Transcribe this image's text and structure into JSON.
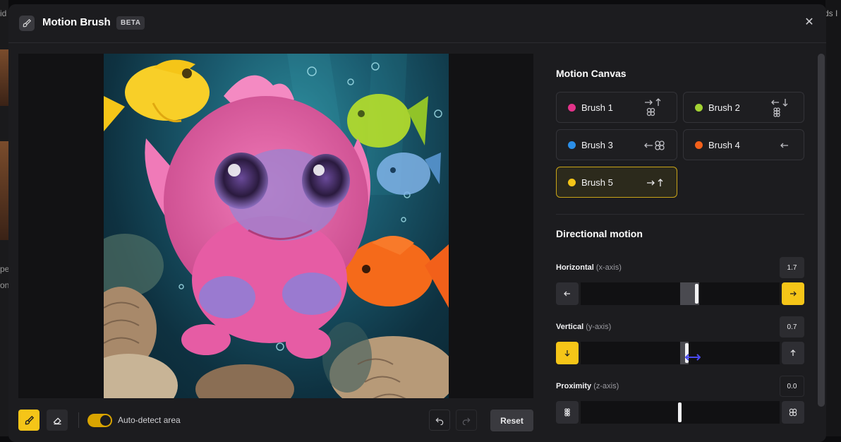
{
  "background": {
    "left_text": [
      "id",
      "pe",
      "on"
    ],
    "right_text": "ds I"
  },
  "header": {
    "title": "Motion Brush",
    "badge": "BETA",
    "icon": "brush-icon",
    "close_icon": "close-icon"
  },
  "toolbar": {
    "brush_icon": "brush-icon",
    "eraser_icon": "eraser-icon",
    "auto_detect_label": "Auto-detect area",
    "auto_detect_on": true,
    "undo_icon": "undo-icon",
    "redo_icon": "redo-icon",
    "reset_label": "Reset"
  },
  "panel": {
    "motion_canvas_title": "Motion Canvas",
    "brushes": [
      {
        "label": "Brush 1",
        "color": "#e3338a",
        "directions": [
          "right-arrow",
          "up-arrow",
          "proximity-icon"
        ]
      },
      {
        "label": "Brush 2",
        "color": "#a3d233",
        "directions": [
          "left-arrow",
          "down-arrow",
          "proximity-icon"
        ]
      },
      {
        "label": "Brush 3",
        "color": "#2b8fe8",
        "directions": [
          "left-arrow",
          "proximity-icon"
        ]
      },
      {
        "label": "Brush 4",
        "color": "#f2601a",
        "directions": [
          "left-arrow"
        ]
      },
      {
        "label": "Brush 5",
        "color": "#f5c518",
        "directions": [
          "right-arrow",
          "up-arrow"
        ],
        "selected": true
      }
    ],
    "directional_title": "Directional motion",
    "horizontal": {
      "label": "Horizontal",
      "sub": "(x-axis)",
      "value": "1.7"
    },
    "vertical": {
      "label": "Vertical",
      "sub": "(y-axis)",
      "value": "0.7"
    },
    "proximity": {
      "label": "Proximity",
      "sub": "(z-axis)",
      "value": "0.0"
    }
  },
  "colors": {
    "accent": "#f5c518",
    "panel_bg": "#1c1c1f"
  }
}
